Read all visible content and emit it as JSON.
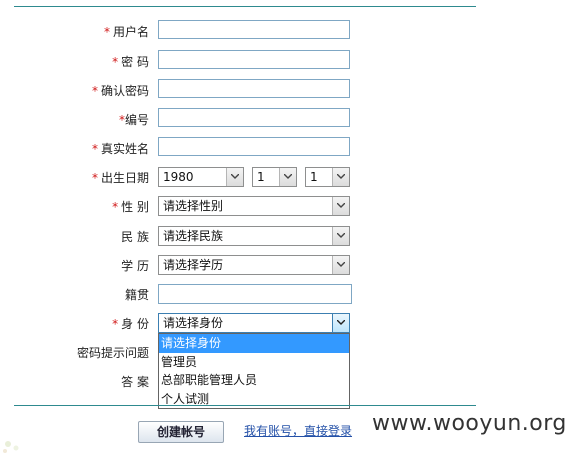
{
  "form": {
    "username": {
      "label": "用户名",
      "required": true,
      "value": ""
    },
    "password": {
      "label": "密 码",
      "required": true,
      "value": ""
    },
    "confirm_password": {
      "label": "确认密码",
      "required": true,
      "value": ""
    },
    "number": {
      "label": "编号",
      "required": true,
      "value": ""
    },
    "real_name": {
      "label": "真实姓名",
      "required": true,
      "value": ""
    },
    "birth_date": {
      "label": "出生日期",
      "required": true,
      "year": "1980",
      "month": "1",
      "day": "1"
    },
    "gender": {
      "label": "性 别",
      "required": true,
      "selected": "请选择性别"
    },
    "ethnicity": {
      "label": "民 族",
      "selected": "请选择民族"
    },
    "education": {
      "label": "学 历",
      "selected": "请选择学历"
    },
    "native_place": {
      "label": "籍贯",
      "value": ""
    },
    "identity": {
      "label": "身 份",
      "required": true,
      "selected": "请选择身份",
      "options": [
        "请选择身份",
        "管理员",
        "总部职能管理人员",
        "个人试测"
      ]
    },
    "hint_question": {
      "label": "密码提示问题"
    },
    "answer": {
      "label": "答 案"
    }
  },
  "required_mark": "*",
  "actions": {
    "submit_label": "创建帐号",
    "login_link": "我有账号，直接登录"
  },
  "watermark": "www.wooyun.org",
  "colors": {
    "accent_line": "#2e8a8f",
    "required": "#d01818",
    "highlight": "#3399ff",
    "link": "#2451a8"
  }
}
